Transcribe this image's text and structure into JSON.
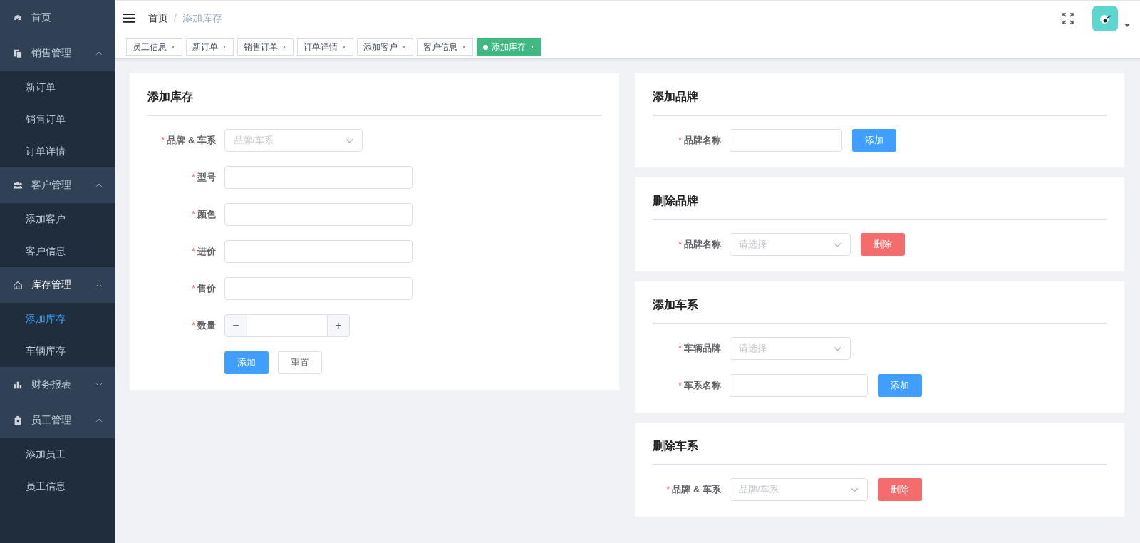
{
  "sidebar": {
    "items": [
      {
        "label": "首页"
      },
      {
        "label": "销售管理",
        "expanded": true,
        "children": [
          {
            "label": "新订单",
            "selected": false
          },
          {
            "label": "销售订单",
            "selected": false
          },
          {
            "label": "订单详情",
            "selected": false
          }
        ]
      },
      {
        "label": "客户管理",
        "expanded": true,
        "children": [
          {
            "label": "添加客户",
            "selected": false
          },
          {
            "label": "客户信息",
            "selected": false
          }
        ]
      },
      {
        "label": "库存管理",
        "expanded": true,
        "children": [
          {
            "label": "添加库存",
            "selected": true
          },
          {
            "label": "车辆库存",
            "selected": false
          }
        ]
      },
      {
        "label": "财务报表",
        "expanded": false
      },
      {
        "label": "员工管理",
        "expanded": true,
        "children": [
          {
            "label": "添加员工",
            "selected": false
          },
          {
            "label": "员工信息",
            "selected": false
          }
        ]
      }
    ]
  },
  "breadcrumb": {
    "separator": "/",
    "items": [
      "首页",
      "添加库存"
    ]
  },
  "tabs": [
    {
      "label": "员工信息",
      "selected": false
    },
    {
      "label": "新订单",
      "selected": false
    },
    {
      "label": "销售订单",
      "selected": false
    },
    {
      "label": "订单详情",
      "selected": false
    },
    {
      "label": "添加客户",
      "selected": false
    },
    {
      "label": "客户信息",
      "selected": false
    },
    {
      "label": "添加库存",
      "selected": true
    }
  ],
  "add_stock": {
    "title": "添加库存",
    "fields": [
      {
        "label": "品牌 & 车系",
        "required_mark": "*",
        "kind": "select",
        "placeholder": "品牌/车系"
      },
      {
        "label": "型号",
        "required_mark": "*",
        "kind": "input"
      },
      {
        "label": "颜色",
        "required_mark": "*",
        "kind": "input"
      },
      {
        "label": "进价",
        "required_mark": "*",
        "kind": "input"
      },
      {
        "label": "售价",
        "required_mark": "*",
        "kind": "input"
      },
      {
        "label": "数量",
        "required_mark": "*",
        "kind": "number",
        "minus": "−",
        "plus": "+"
      }
    ],
    "buttons": [
      {
        "label": "添加",
        "kind": "primary"
      },
      {
        "label": "重置",
        "kind": "default"
      }
    ]
  },
  "side_cards": [
    {
      "title": "添加品牌",
      "fields": [
        {
          "label": "品牌名称",
          "required_mark": "*",
          "kind": "input",
          "button": {
            "label": "添加",
            "kind": "primary"
          }
        }
      ]
    },
    {
      "title": "删除品牌",
      "fields": [
        {
          "label": "品牌名称",
          "required_mark": "*",
          "kind": "select",
          "placeholder": "请选择",
          "button": {
            "label": "删除",
            "kind": "danger"
          }
        }
      ]
    },
    {
      "title": "添加车系",
      "fields": [
        {
          "label": "车辆品牌",
          "required_mark": "*",
          "kind": "select",
          "placeholder": "请选择"
        },
        {
          "label": "车系名称",
          "required_mark": "*",
          "kind": "input",
          "button": {
            "label": "添加",
            "kind": "primary"
          }
        }
      ]
    },
    {
      "title": "删除车系",
      "fields": [
        {
          "label": "品牌 & 车系",
          "required_mark": "*",
          "kind": "select",
          "placeholder": "品牌/车系",
          "button": {
            "label": "删除",
            "kind": "danger"
          }
        }
      ]
    }
  ]
}
